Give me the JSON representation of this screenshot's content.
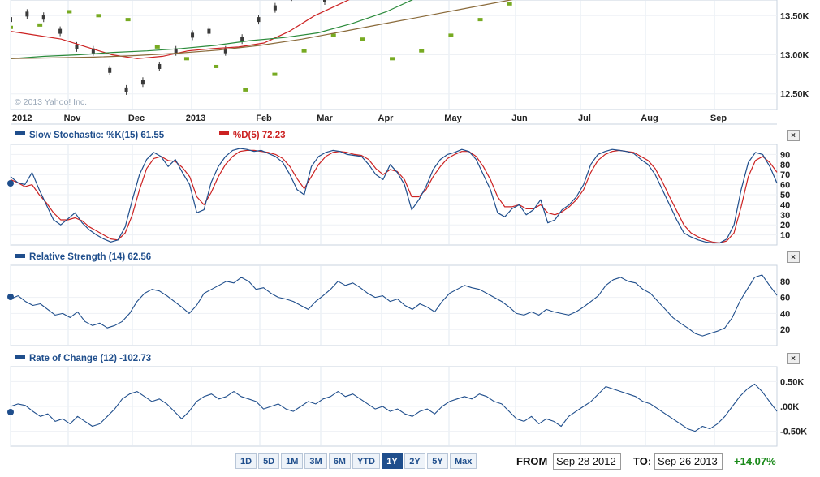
{
  "price_panel": {
    "y_ticks": [
      "13.50K",
      "13.00K",
      "12.50K"
    ],
    "watermark": "© 2013 Yahoo! Inc."
  },
  "x_axis": {
    "labels": [
      "2012",
      "Nov",
      "Dec",
      "2013",
      "Feb",
      "Mar",
      "Apr",
      "May",
      "Jun",
      "Jul",
      "Aug",
      "Sep"
    ]
  },
  "stochastic": {
    "k_label": "Slow Stochastic: %K(15) 61.55",
    "d_label": "%D(5) 72.23",
    "y_ticks": [
      "90",
      "80",
      "70",
      "60",
      "50",
      "40",
      "30",
      "20",
      "10"
    ],
    "k_color": "#1f4e8c",
    "d_color": "#cc2222"
  },
  "rsi": {
    "label": "Relative Strength (14) 62.56",
    "y_ticks": [
      "80",
      "60",
      "40",
      "20"
    ]
  },
  "roc": {
    "label": "Rate of Change (12) -102.73",
    "y_ticks": [
      "0.50K",
      ".00K",
      "-0.50K"
    ]
  },
  "controls": {
    "ranges": [
      "1D",
      "5D",
      "1M",
      "3M",
      "6M",
      "YTD",
      "1Y",
      "2Y",
      "5Y",
      "Max"
    ],
    "active_range": "1Y",
    "from_label": "FROM",
    "from_value": "Sep 28 2012",
    "to_label": "TO:",
    "to_value": "Sep 26 2013",
    "change": "+14.07%",
    "close_glyph": "×"
  },
  "chart_data": [
    {
      "type": "line",
      "title": "",
      "x_labels": [
        "2012",
        "Nov",
        "Dec",
        "2013",
        "Feb",
        "Mar",
        "Apr",
        "May",
        "Jun",
        "Jul",
        "Aug",
        "Sep"
      ],
      "ylim": [
        12.3,
        13.7
      ],
      "y_unit": "K",
      "series": [
        {
          "name": "",
          "kind": "price candles",
          "color": "#3a3a3a",
          "values": [
            13.45,
            13.52,
            13.48,
            13.3,
            13.1,
            13.05,
            12.8,
            12.55,
            12.65,
            12.85,
            13.05,
            13.25,
            13.3,
            13.05,
            13.2,
            13.45,
            13.6,
            13.75,
            13.85,
            13.7
          ]
        },
        {
          "name": "",
          "kind": "parabolic SAR",
          "color": "#77aa22",
          "values": [
            13.35,
            13.38,
            13.55,
            13.5,
            13.45,
            13.1,
            12.95,
            12.85,
            12.55,
            12.75,
            13.05,
            13.25,
            13.2,
            12.95,
            13.05,
            13.25,
            13.45,
            13.65,
            13.8,
            13.95
          ]
        },
        {
          "name": "",
          "kind": "moving average (short)",
          "color": "#cc2222",
          "values": [
            13.3,
            13.25,
            13.2,
            13.1,
            13.0,
            12.95,
            12.98,
            13.05,
            13.08,
            13.1,
            13.15,
            13.3,
            13.5,
            13.65,
            13.8
          ]
        },
        {
          "name": "",
          "kind": "moving average (medium)",
          "color": "#2a8a3a",
          "values": [
            12.95,
            12.98,
            13.0,
            13.03,
            13.05,
            13.08,
            13.12,
            13.18,
            13.22,
            13.28,
            13.4,
            13.55,
            13.75,
            13.95
          ]
        },
        {
          "name": "",
          "kind": "moving average (long)",
          "color": "#8a6a3a",
          "values": [
            12.95,
            12.96,
            12.97,
            12.99,
            13.02,
            13.06,
            13.12,
            13.2,
            13.3,
            13.4,
            13.5,
            13.6,
            13.7,
            13.8
          ]
        }
      ]
    },
    {
      "type": "line",
      "title": "Slow Stochastic: %K(15) 61.55",
      "ylim": [
        0,
        100
      ],
      "series": [
        {
          "name": "%K(15)",
          "color": "#1f4e8c",
          "values": [
            68,
            62,
            60,
            72,
            55,
            40,
            25,
            20,
            26,
            32,
            22,
            15,
            10,
            6,
            3,
            5,
            18,
            45,
            70,
            85,
            92,
            88,
            78,
            85,
            72,
            60,
            32,
            35,
            62,
            78,
            88,
            94,
            96,
            95,
            93,
            94,
            91,
            88,
            82,
            70,
            55,
            50,
            78,
            88,
            92,
            94,
            93,
            90,
            89,
            88,
            80,
            70,
            65,
            80,
            72,
            60,
            35,
            45,
            58,
            75,
            85,
            90,
            92,
            95,
            93,
            85,
            70,
            55,
            32,
            28,
            36,
            40,
            30,
            35,
            45,
            22,
            25,
            35,
            40,
            48,
            60,
            80,
            90,
            93,
            95,
            94,
            93,
            91,
            85,
            80,
            70,
            55,
            40,
            25,
            12,
            8,
            5,
            3,
            2,
            2,
            6,
            20,
            55,
            82,
            92,
            90,
            78,
            61.55
          ]
        },
        {
          "name": "%D(5)",
          "color": "#cc2222",
          "values": [
            65,
            62,
            58,
            60,
            50,
            42,
            32,
            25,
            25,
            27,
            24,
            18,
            14,
            10,
            6,
            5,
            12,
            30,
            55,
            76,
            86,
            88,
            84,
            83,
            77,
            68,
            48,
            40,
            52,
            68,
            80,
            88,
            93,
            94,
            94,
            93,
            92,
            90,
            86,
            78,
            66,
            56,
            68,
            80,
            88,
            92,
            93,
            92,
            90,
            89,
            85,
            76,
            70,
            75,
            73,
            65,
            48,
            48,
            55,
            68,
            78,
            86,
            90,
            93,
            93,
            88,
            78,
            65,
            48,
            38,
            38,
            40,
            36,
            36,
            40,
            32,
            30,
            33,
            38,
            45,
            55,
            72,
            84,
            90,
            93,
            94,
            93,
            92,
            88,
            84,
            76,
            63,
            48,
            34,
            20,
            12,
            8,
            5,
            3,
            2,
            4,
            12,
            38,
            68,
            84,
            88,
            82,
            72.23
          ]
        }
      ]
    },
    {
      "type": "line",
      "title": "Relative Strength (14) 62.56",
      "ylim": [
        0,
        100
      ],
      "series": [
        {
          "name": "RSI(14)",
          "color": "#1f4e8c",
          "values": [
            58,
            62,
            55,
            50,
            52,
            45,
            38,
            40,
            35,
            42,
            30,
            25,
            28,
            22,
            25,
            30,
            40,
            55,
            65,
            70,
            68,
            62,
            55,
            48,
            40,
            50,
            65,
            70,
            75,
            80,
            78,
            85,
            80,
            70,
            72,
            65,
            60,
            58,
            55,
            50,
            45,
            55,
            62,
            70,
            80,
            75,
            78,
            72,
            65,
            60,
            62,
            55,
            58,
            50,
            45,
            52,
            48,
            42,
            55,
            65,
            70,
            75,
            72,
            70,
            65,
            60,
            55,
            48,
            40,
            38,
            42,
            38,
            45,
            42,
            40,
            38,
            42,
            48,
            55,
            62,
            75,
            82,
            85,
            80,
            78,
            70,
            65,
            55,
            45,
            35,
            28,
            22,
            15,
            12,
            15,
            18,
            22,
            35,
            55,
            70,
            85,
            88,
            75,
            62.56
          ]
        }
      ]
    },
    {
      "type": "line",
      "title": "Rate of Change (12) -102.73",
      "ylim": [
        -0.8,
        0.8
      ],
      "y_unit": "K",
      "series": [
        {
          "name": "ROC(12)",
          "color": "#1f4e8c",
          "values": [
            0.0,
            0.05,
            0.02,
            -0.1,
            -0.2,
            -0.15,
            -0.3,
            -0.25,
            -0.35,
            -0.2,
            -0.3,
            -0.4,
            -0.35,
            -0.2,
            -0.05,
            0.15,
            0.25,
            0.3,
            0.2,
            0.1,
            0.15,
            0.05,
            -0.1,
            -0.25,
            -0.1,
            0.1,
            0.2,
            0.25,
            0.15,
            0.2,
            0.3,
            0.2,
            0.15,
            0.1,
            -0.05,
            0.0,
            0.05,
            -0.05,
            -0.1,
            0.0,
            0.1,
            0.05,
            0.15,
            0.2,
            0.3,
            0.2,
            0.25,
            0.15,
            0.05,
            -0.05,
            0.0,
            -0.1,
            -0.05,
            -0.15,
            -0.2,
            -0.1,
            -0.05,
            -0.15,
            0.0,
            0.1,
            0.15,
            0.2,
            0.15,
            0.25,
            0.2,
            0.1,
            0.05,
            -0.1,
            -0.25,
            -0.3,
            -0.2,
            -0.35,
            -0.25,
            -0.3,
            -0.4,
            -0.2,
            -0.1,
            0.0,
            0.1,
            0.25,
            0.4,
            0.35,
            0.3,
            0.25,
            0.2,
            0.1,
            0.05,
            -0.05,
            -0.15,
            -0.25,
            -0.35,
            -0.45,
            -0.5,
            -0.4,
            -0.45,
            -0.35,
            -0.2,
            0.0,
            0.2,
            0.35,
            0.45,
            0.3,
            0.1,
            -0.1
          ]
        }
      ]
    }
  ]
}
